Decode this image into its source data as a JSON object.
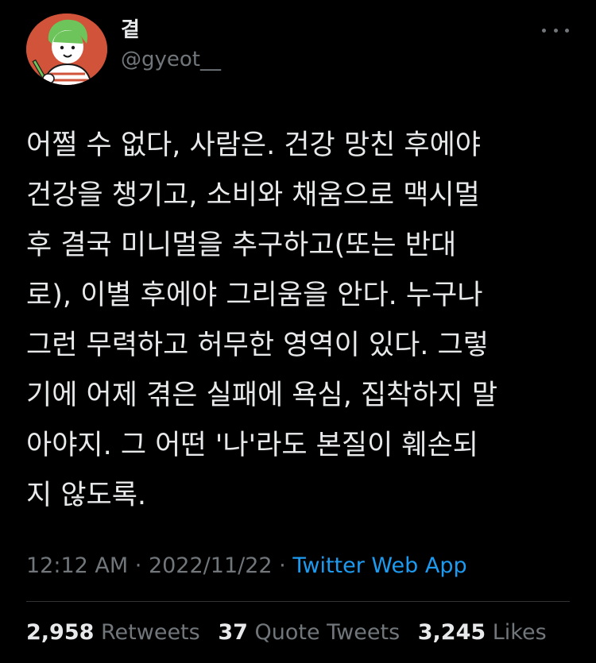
{
  "author": {
    "display_name": "곁",
    "handle": "@gyeot__"
  },
  "tweet": {
    "text": "어쩔 수 없다, 사람은. 건강 망친 후에야\n건강을 챙기고, 소비와 채움으로 맥시멀\n후 결국 미니멀을 추구하고(또는 반대\n로), 이별 후에야 그리움을 안다. 누구나\n그런 무력하고 허무한 영역이 있다. 그렇\n기에 어제 겪은 실패에 욕심, 집착하지 말\n아야지. 그 어떤 '나'라도 본질이 훼손되\n지 않도록."
  },
  "meta": {
    "time": "12:12 AM",
    "separator": "·",
    "date": "2022/11/22",
    "source": "Twitter Web App"
  },
  "stats": {
    "retweets_count": "2,958",
    "retweets_label": "Retweets",
    "quotes_count": "37",
    "quotes_label": "Quote Tweets",
    "likes_count": "3,245",
    "likes_label": "Likes"
  },
  "colors": {
    "background": "#000000",
    "primary_text": "#e7e9ea",
    "secondary_text": "#71767b",
    "link": "#1d9bf0",
    "avatar_bg": "#d1533a"
  },
  "icons": {
    "more": "more-horizontal-icon",
    "avatar": "illustrated-avatar"
  }
}
